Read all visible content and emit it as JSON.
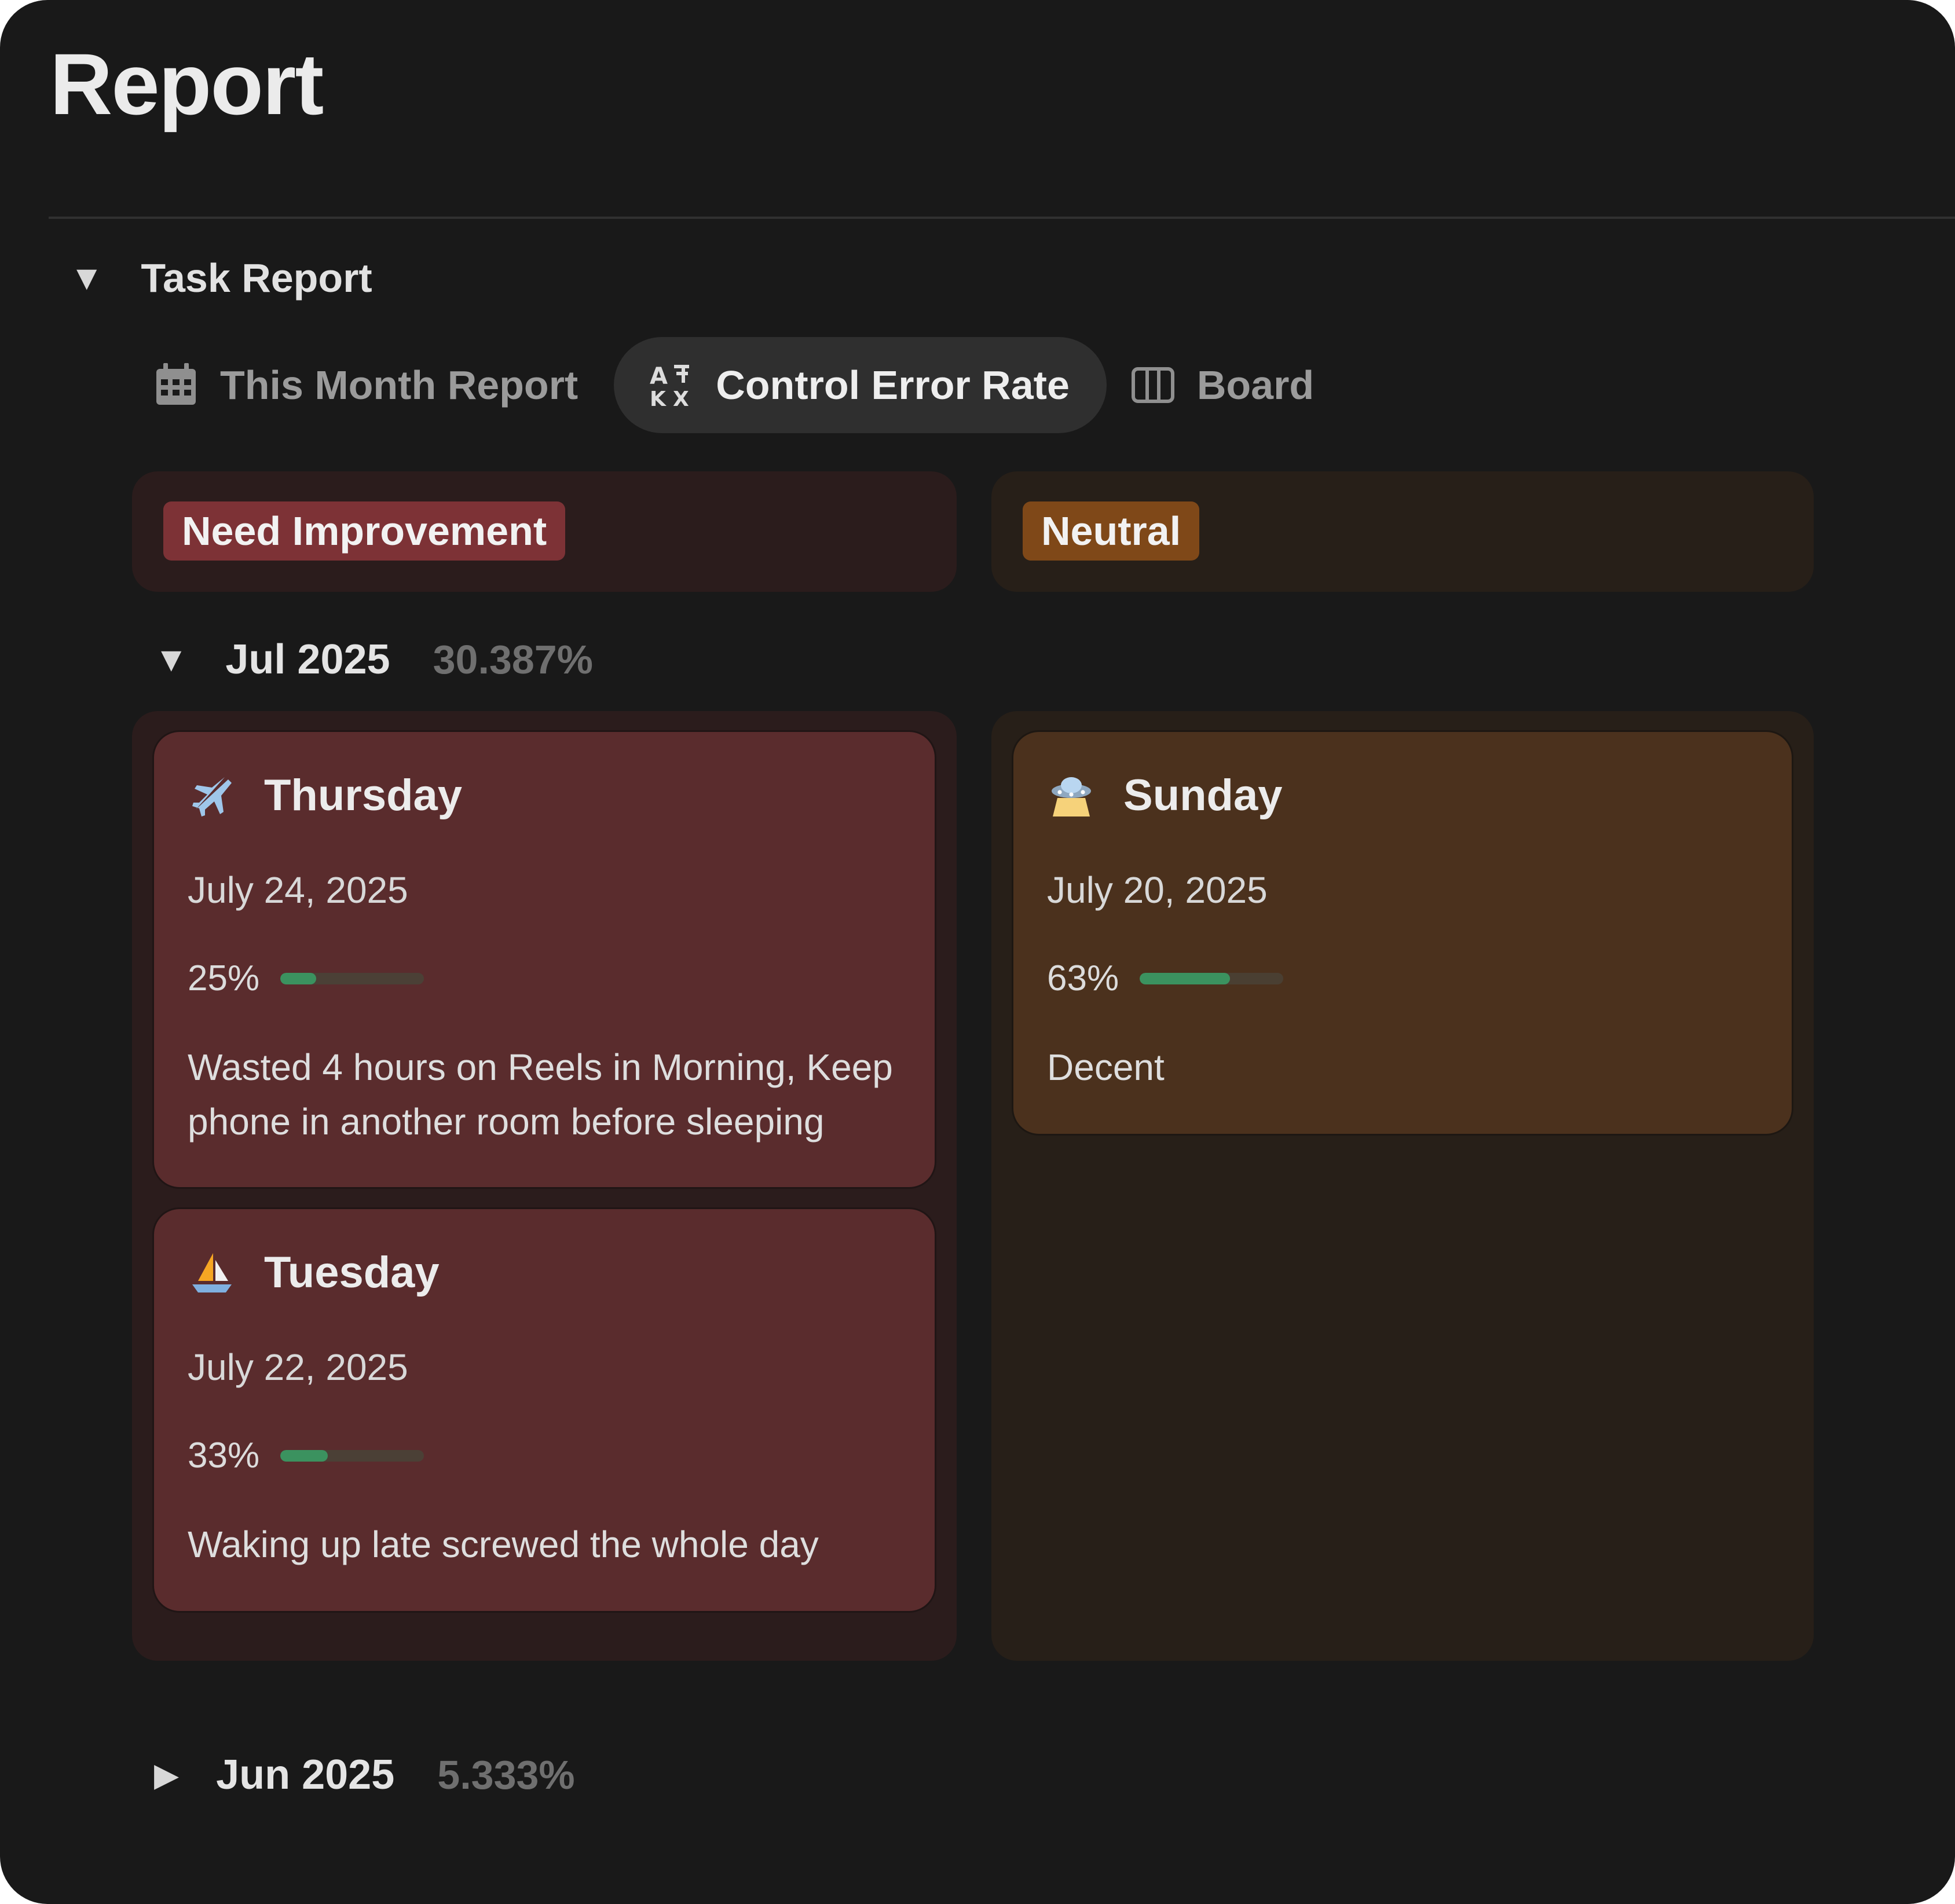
{
  "page": {
    "title": "Report"
  },
  "section": {
    "title": "Task Report"
  },
  "tabs": [
    {
      "label": "This Month Report",
      "icon": "calendar-icon",
      "active": false
    },
    {
      "label": "Control Error Rate",
      "icon": "translate-icon",
      "active": true
    },
    {
      "label": "Board",
      "icon": "board-columns-icon",
      "active": false
    }
  ],
  "columns": [
    {
      "label": "Need Improvement",
      "color": "#7d3236"
    },
    {
      "label": "Neutral",
      "color": "#7f4818"
    }
  ],
  "groups": [
    {
      "label": "Jul 2025",
      "value": "30.387%",
      "expanded": true
    },
    {
      "label": "Jun 2025",
      "value": "5.333%",
      "expanded": false
    }
  ],
  "cards": [
    {
      "day": "Thursday",
      "icon": "airplane-icon",
      "date": "July 24, 2025",
      "progress_label": "25%",
      "progress": 0.25,
      "note": "Wasted 4 hours on Reels in Morning, Keep phone in another room before sleeping"
    },
    {
      "day": "Tuesday",
      "icon": "sailboat-icon",
      "date": "July 22, 2025",
      "progress_label": "33%",
      "progress": 0.33,
      "note": "Waking up late screwed the whole day"
    },
    {
      "day": "Sunday",
      "icon": "ufo-icon",
      "date": "July 20, 2025",
      "progress_label": "63%",
      "progress": 0.63,
      "note": "Decent"
    }
  ],
  "colors": {
    "progress_fill": "#3b925f",
    "background": "#191919"
  }
}
